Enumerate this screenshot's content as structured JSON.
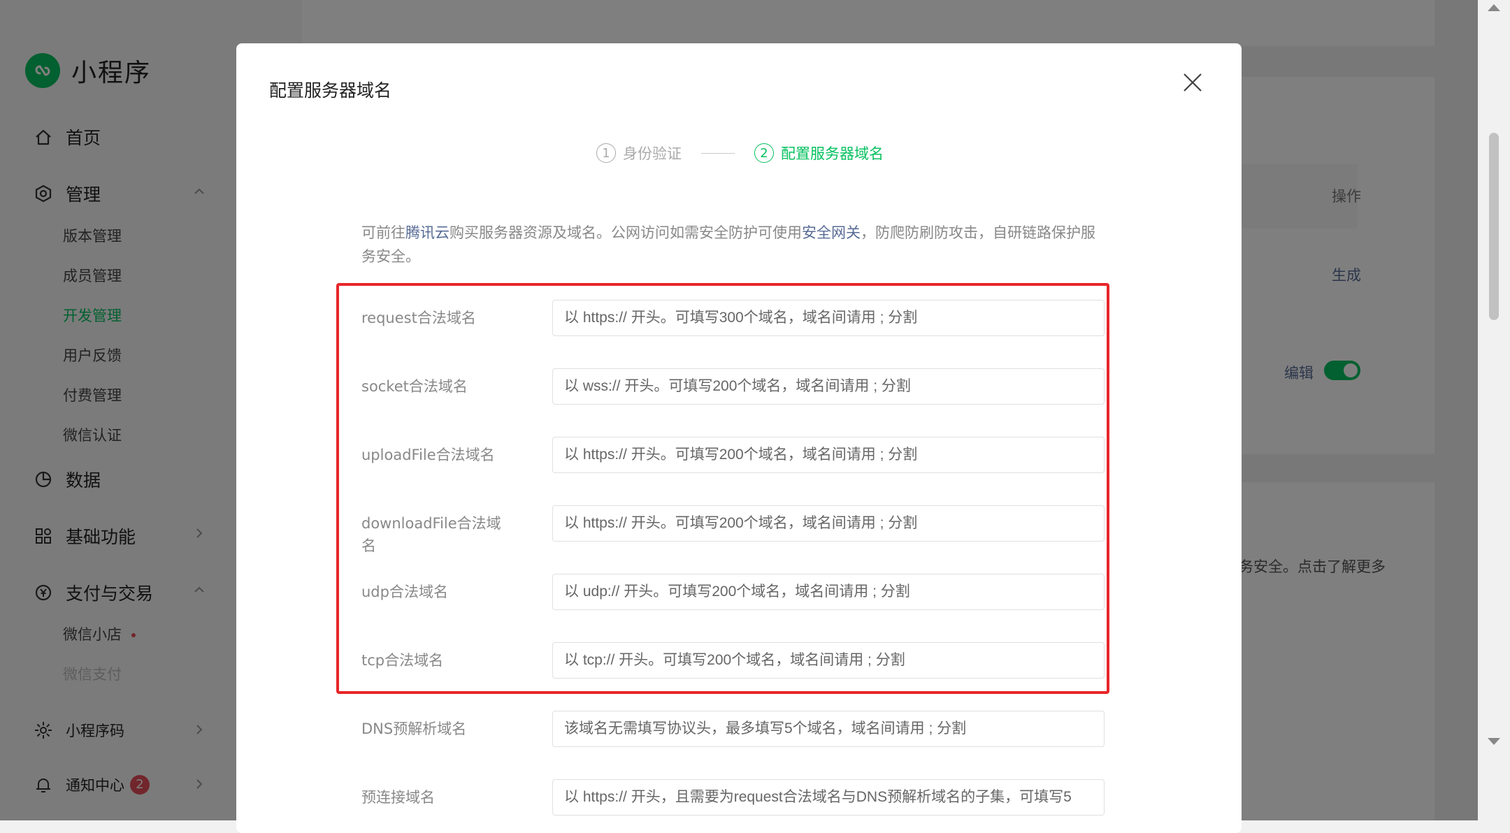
{
  "app": {
    "logo_text": "小程序",
    "brand_color": "#07c160"
  },
  "sidebar": {
    "home": "首页",
    "manage": "管理",
    "manage_items": [
      {
        "label": "版本管理"
      },
      {
        "label": "成员管理"
      },
      {
        "label": "开发管理"
      },
      {
        "label": "用户反馈"
      },
      {
        "label": "付费管理"
      },
      {
        "label": "微信认证"
      }
    ],
    "data": "数据",
    "basic": "基础功能",
    "pay": "支付与交易",
    "pay_items": [
      {
        "label": "微信小店"
      },
      {
        "label": "微信支付"
      }
    ],
    "qrcode": "小程序码",
    "notify": "通知中心",
    "notify_count": "2"
  },
  "background": {
    "col_header": "操作",
    "generate_link": "生成",
    "edit_link": "编辑",
    "learn_more_text": "务安全。点击了解更多"
  },
  "dialog": {
    "title": "配置服务器域名",
    "steps": [
      {
        "num": "1",
        "label": "身份验证",
        "active": false
      },
      {
        "num": "2",
        "label": "配置服务器域名",
        "active": true
      }
    ],
    "notice": {
      "part1": "可前往",
      "link1": "腾讯云",
      "part2": "购买服务器资源及域名。公网访问如需安全防护可使用",
      "link2": "安全网关",
      "part3": "，防爬防刷防攻击，自研链路保护服务安全。"
    },
    "fields": [
      {
        "label": "request合法域名",
        "placeholder": "以 https:// 开头。可填写300个域名，域名间请用 ; 分割"
      },
      {
        "label": "socket合法域名",
        "placeholder": "以 wss:// 开头。可填写200个域名，域名间请用 ; 分割"
      },
      {
        "label": "uploadFile合法域名",
        "placeholder": "以 https:// 开头。可填写200个域名，域名间请用 ; 分割"
      },
      {
        "label": "downloadFile合法域名",
        "placeholder": "以 https:// 开头。可填写200个域名，域名间请用 ; 分割"
      },
      {
        "label": "udp合法域名",
        "placeholder": "以 udp:// 开头。可填写200个域名，域名间请用 ; 分割"
      },
      {
        "label": "tcp合法域名",
        "placeholder": "以 tcp:// 开头。可填写200个域名，域名间请用 ; 分割"
      },
      {
        "label": "DNS预解析域名",
        "placeholder": "该域名无需填写协议头，最多填写5个域名，域名间请用 ; 分割"
      },
      {
        "label": "预连接域名",
        "placeholder": "以 https:// 开头，且需要为request合法域名与DNS预解析域名的子集，可填写5"
      }
    ],
    "highlight_color": "#e8262a"
  }
}
